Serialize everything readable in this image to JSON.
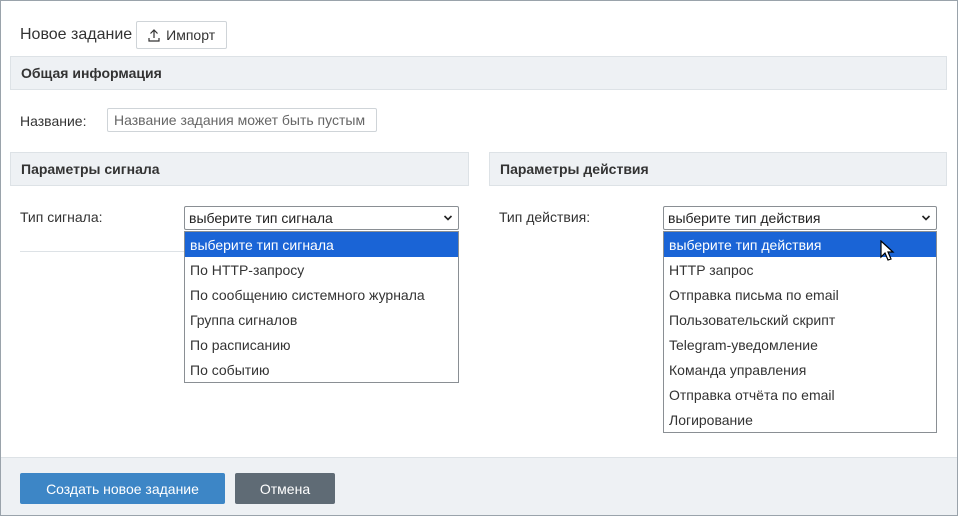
{
  "header": {
    "title": "Новое задание",
    "import_label": "Импорт"
  },
  "general": {
    "section_title": "Общая информация",
    "name_label": "Название:",
    "name_placeholder": "Название задания может быть пустым",
    "name_value": ""
  },
  "signal": {
    "section_title": "Параметры сигнала",
    "type_label": "Тип сигнала:",
    "selected": "выберите тип сигнала",
    "options": [
      "выберите тип сигнала",
      "По HTTP-запросу",
      "По сообщению системного журнала",
      "Группа сигналов",
      "По расписанию",
      "По событию"
    ]
  },
  "action": {
    "section_title": "Параметры действия",
    "type_label": "Тип действия:",
    "selected": "выберите тип действия",
    "options": [
      "выберите тип действия",
      "HTTP запрос",
      "Отправка письма по email",
      "Пользовательский скрипт",
      "Telegram-уведомление",
      "Команда управления",
      "Отправка отчёта по email",
      "Логирование"
    ]
  },
  "footer": {
    "create_label": "Создать новое задание",
    "cancel_label": "Отмена"
  },
  "colors": {
    "accent": "#3d86c6",
    "selected_option": "#1a64d6",
    "secondary_button": "#5f6b75",
    "section_bg": "#eef1f4"
  }
}
